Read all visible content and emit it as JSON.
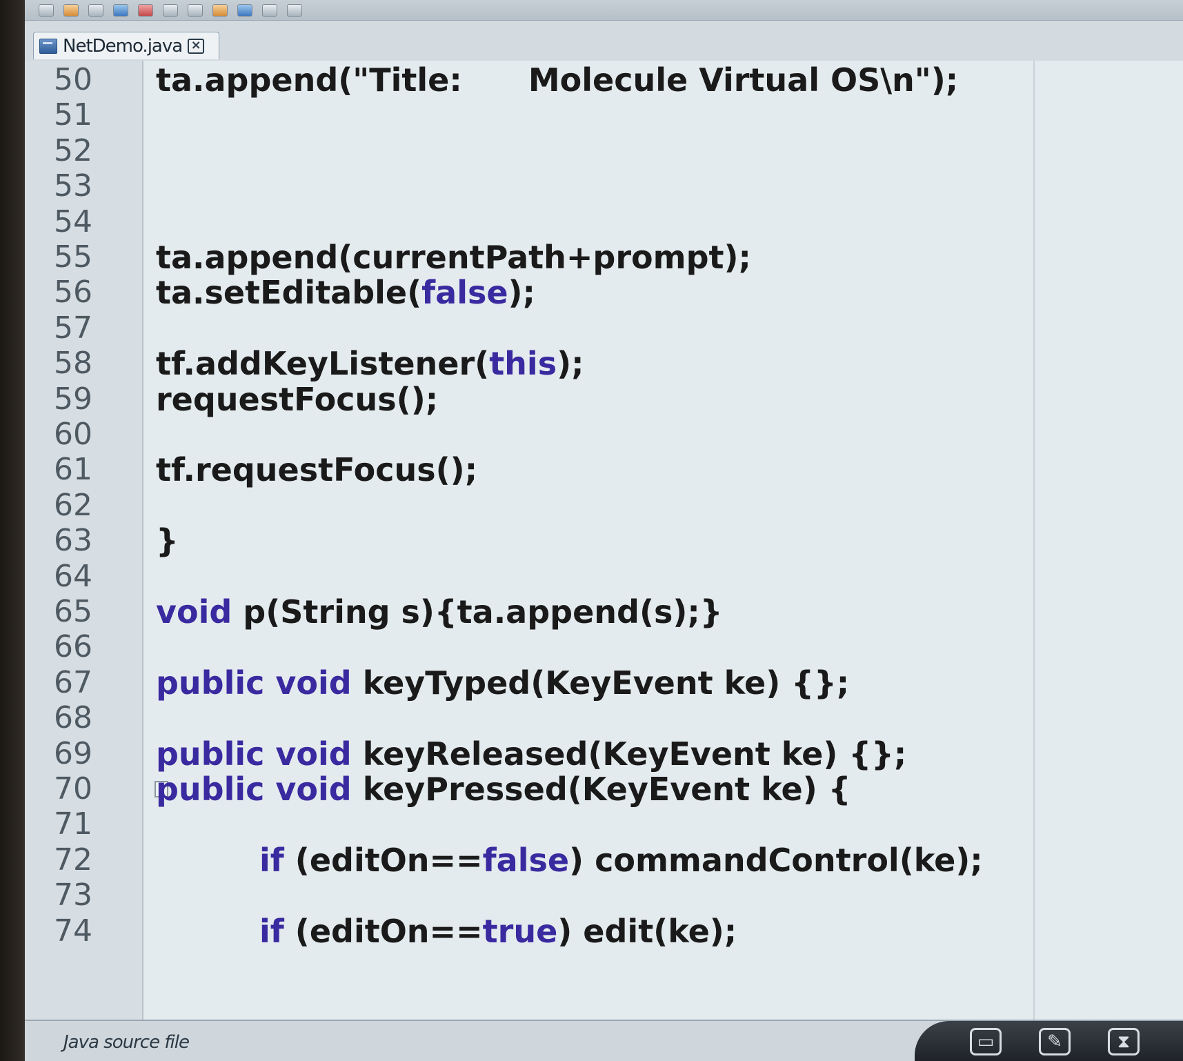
{
  "tab": {
    "label": "NetDemo.java"
  },
  "status": {
    "text": "Java source file"
  },
  "lines": [
    {
      "n": "50",
      "indent": 0,
      "parts": [
        {
          "t": "ta.append(\"Title:      Molecule Virtual OS\\n\");",
          "k": 0
        }
      ]
    },
    {
      "n": "51",
      "indent": 0,
      "parts": []
    },
    {
      "n": "52",
      "indent": 0,
      "parts": []
    },
    {
      "n": "53",
      "indent": 0,
      "parts": []
    },
    {
      "n": "54",
      "indent": 0,
      "parts": []
    },
    {
      "n": "55",
      "indent": 0,
      "parts": [
        {
          "t": "ta.append(currentPath+prompt);",
          "k": 0
        }
      ]
    },
    {
      "n": "56",
      "indent": 0,
      "parts": [
        {
          "t": "ta.setEditable(",
          "k": 0
        },
        {
          "t": "false",
          "k": 1
        },
        {
          "t": ");",
          "k": 0
        }
      ]
    },
    {
      "n": "57",
      "indent": 0,
      "parts": []
    },
    {
      "n": "58",
      "indent": 0,
      "parts": [
        {
          "t": "tf.addKeyListener(",
          "k": 0
        },
        {
          "t": "this",
          "k": 1
        },
        {
          "t": ");",
          "k": 0
        }
      ]
    },
    {
      "n": "59",
      "indent": 0,
      "parts": [
        {
          "t": "requestFocus();",
          "k": 0
        }
      ]
    },
    {
      "n": "60",
      "indent": 0,
      "parts": []
    },
    {
      "n": "61",
      "indent": 0,
      "parts": [
        {
          "t": "tf.requestFocus();",
          "k": 0
        }
      ]
    },
    {
      "n": "62",
      "indent": 0,
      "parts": []
    },
    {
      "n": "63",
      "indent": 0,
      "parts": [
        {
          "t": "}",
          "k": 0
        }
      ]
    },
    {
      "n": "64",
      "indent": 0,
      "parts": []
    },
    {
      "n": "65",
      "indent": 0,
      "parts": [
        {
          "t": "void",
          "k": 1
        },
        {
          "t": " p(String s){ta.append(s);}",
          "k": 0
        }
      ]
    },
    {
      "n": "66",
      "indent": 0,
      "parts": []
    },
    {
      "n": "67",
      "indent": 0,
      "parts": [
        {
          "t": "public void",
          "k": 1
        },
        {
          "t": " keyTyped(KeyEvent ke) {};",
          "k": 0
        }
      ]
    },
    {
      "n": "68",
      "indent": 0,
      "parts": []
    },
    {
      "n": "69",
      "indent": 0,
      "parts": [
        {
          "t": "public void",
          "k": 1
        },
        {
          "t": " keyReleased(KeyEvent ke) {};",
          "k": 0
        }
      ]
    },
    {
      "n": "70",
      "indent": 0,
      "fold": true,
      "parts": [
        {
          "t": "public void",
          "k": 1
        },
        {
          "t": " keyPressed(KeyEvent ke) {",
          "k": 0
        }
      ]
    },
    {
      "n": "71",
      "indent": 0,
      "parts": []
    },
    {
      "n": "72",
      "indent": 1,
      "parts": [
        {
          "t": "if",
          "k": 1
        },
        {
          "t": " (editOn==",
          "k": 0
        },
        {
          "t": "false",
          "k": 1
        },
        {
          "t": ") commandControl(ke);",
          "k": 0
        }
      ]
    },
    {
      "n": "73",
      "indent": 0,
      "parts": []
    },
    {
      "n": "74",
      "indent": 1,
      "parts": [
        {
          "t": "if",
          "k": 1
        },
        {
          "t": " (editOn==",
          "k": 0
        },
        {
          "t": "true",
          "k": 1
        },
        {
          "t": ") edit(ke);",
          "k": 0
        }
      ]
    }
  ]
}
